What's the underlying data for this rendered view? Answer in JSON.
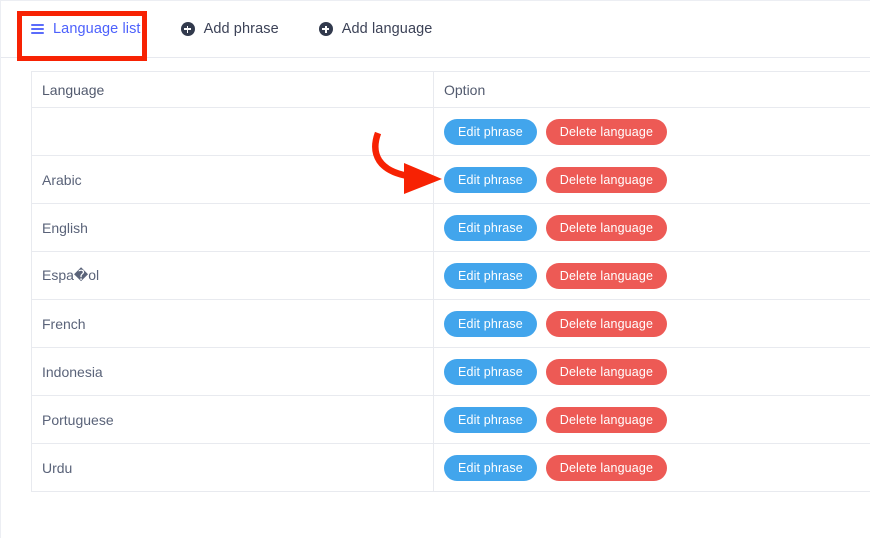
{
  "nav": {
    "items": [
      {
        "label": "Language list",
        "icon": "hamburger-icon",
        "active": true
      },
      {
        "label": "Add phrase",
        "icon": "plus-circle-icon",
        "active": false
      },
      {
        "label": "Add language",
        "icon": "plus-circle-icon",
        "active": false
      }
    ]
  },
  "table": {
    "columns": [
      "Language",
      "Option"
    ],
    "rows": [
      {
        "language": "",
        "edit_label": "Edit phrase",
        "delete_label": "Delete language"
      },
      {
        "language": "Arabic",
        "edit_label": "Edit phrase",
        "delete_label": "Delete language"
      },
      {
        "language": "English",
        "edit_label": "Edit phrase",
        "delete_label": "Delete language"
      },
      {
        "language": "Espa�ol",
        "edit_label": "Edit phrase",
        "delete_label": "Delete language"
      },
      {
        "language": "French",
        "edit_label": "Edit phrase",
        "delete_label": "Delete language"
      },
      {
        "language": "Indonesia",
        "edit_label": "Edit phrase",
        "delete_label": "Delete language"
      },
      {
        "language": "Portuguese",
        "edit_label": "Edit phrase",
        "delete_label": "Delete language"
      },
      {
        "language": "Urdu",
        "edit_label": "Edit phrase",
        "delete_label": "Delete language"
      }
    ]
  },
  "colors": {
    "accent_blue": "#4d61fc",
    "edit_button": "#42a5ec",
    "delete_button": "#ed5a55",
    "annotation_red": "#f72203",
    "text": "#5a6379",
    "border": "#e8eaef"
  },
  "annotations": {
    "highlight_box_target": "Language list",
    "arrow_target": "Edit phrase"
  }
}
